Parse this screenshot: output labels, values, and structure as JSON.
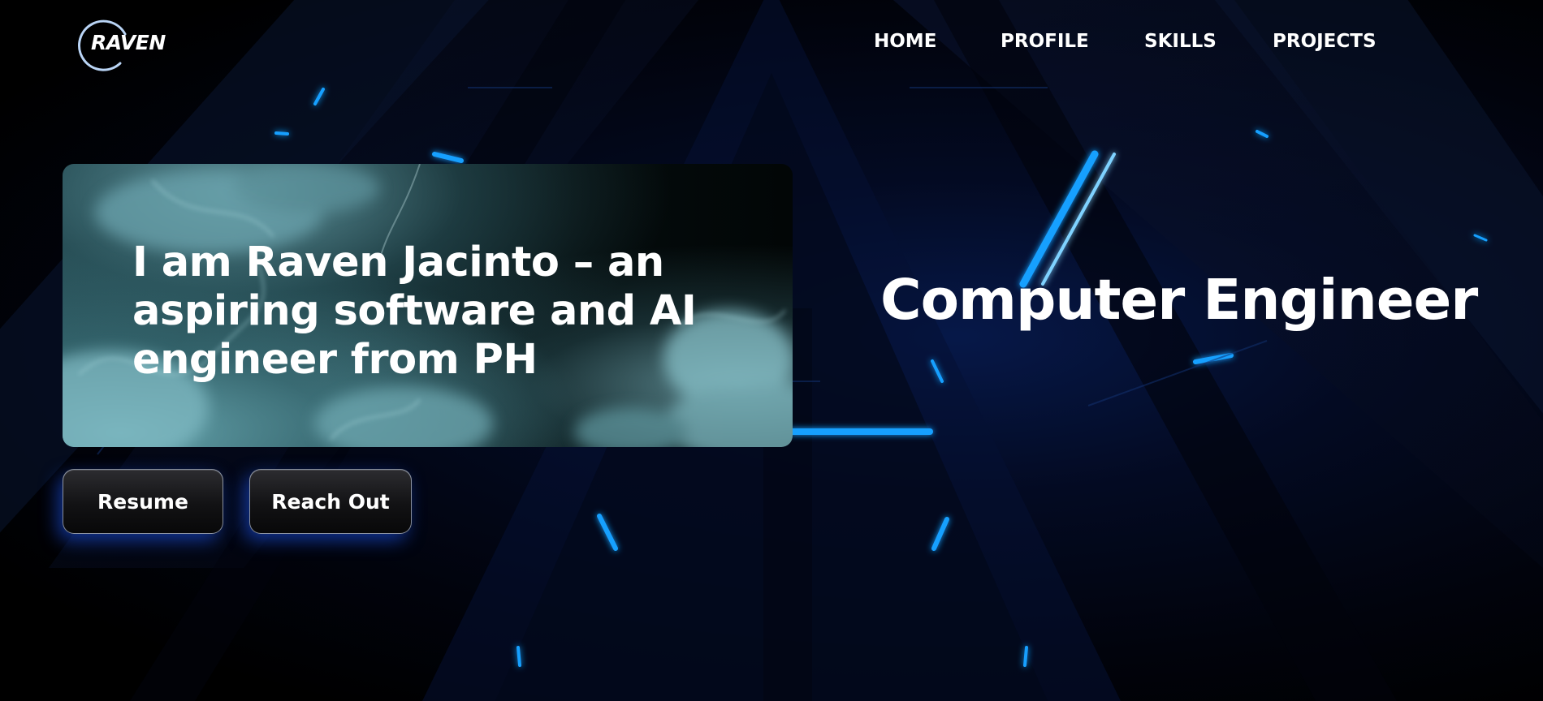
{
  "header": {
    "logo_text": "RAVEN",
    "nav": [
      {
        "label": "HOME"
      },
      {
        "label": "PROFILE"
      },
      {
        "label": "SKILLS"
      },
      {
        "label": "PROJECTS"
      }
    ]
  },
  "hero": {
    "title": "I am Raven Jacinto – an aspiring software and AI engineer from PH",
    "subtitle": "Computer Engineer"
  },
  "buttons": {
    "resume_label": "Resume",
    "reach_out_label": "Reach Out"
  },
  "colors": {
    "accent_glow": "#1e5aff",
    "neon_blue": "#1aa0ff",
    "text": "#ffffff",
    "background": "#02050f"
  }
}
